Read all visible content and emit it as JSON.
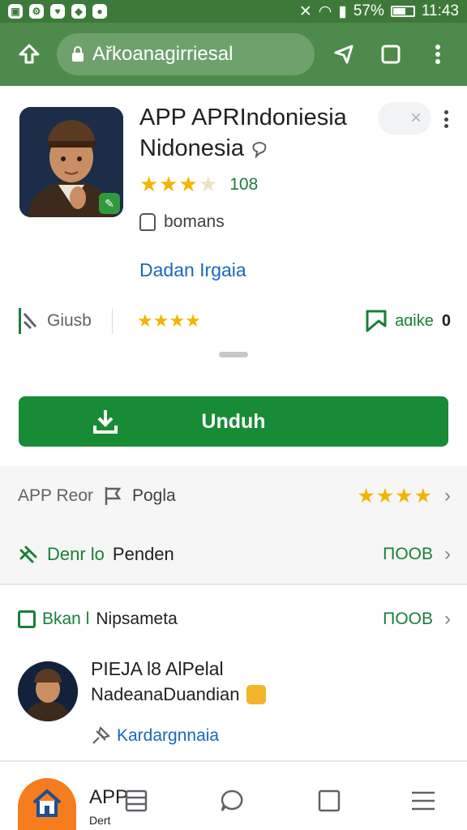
{
  "status_bar": {
    "battery": "57%",
    "time": "11:43",
    "battery_level": 0.57
  },
  "toolbar": {
    "url": "Ařkoanagirriesal"
  },
  "app": {
    "title_line1": "APP APRIndoniesia",
    "title_line2": "Nidonesia",
    "rating_count": "108",
    "developer": "bomans",
    "developer_link": "Dadan Irgaia",
    "close_label": "×"
  },
  "info_strip": {
    "left_label": "Giusb",
    "right_label": "aɑike",
    "right_value": "0"
  },
  "install": {
    "label": "Unduh"
  },
  "rows": {
    "row1_label": "APP Reor",
    "row1_sub": "Pogla",
    "row2_green": "Denr lo",
    "row2_dark": "Penden",
    "row2_value": "ΠOOB",
    "row3_green": "Bkan l",
    "row3_dark": "Nipsameta",
    "row3_value": "ΠOOB"
  },
  "review": {
    "name": "PIEJA l8 AlPelal",
    "text": "NadeanaDuandian",
    "link": "Kardargnnaia"
  },
  "bottom_nav": {
    "label": "APP",
    "sub": "Dert"
  },
  "colors": {
    "green": "#178b35",
    "toolbar": "#4e8a4b",
    "star": "#f4b400",
    "orange": "#f57c1f"
  }
}
